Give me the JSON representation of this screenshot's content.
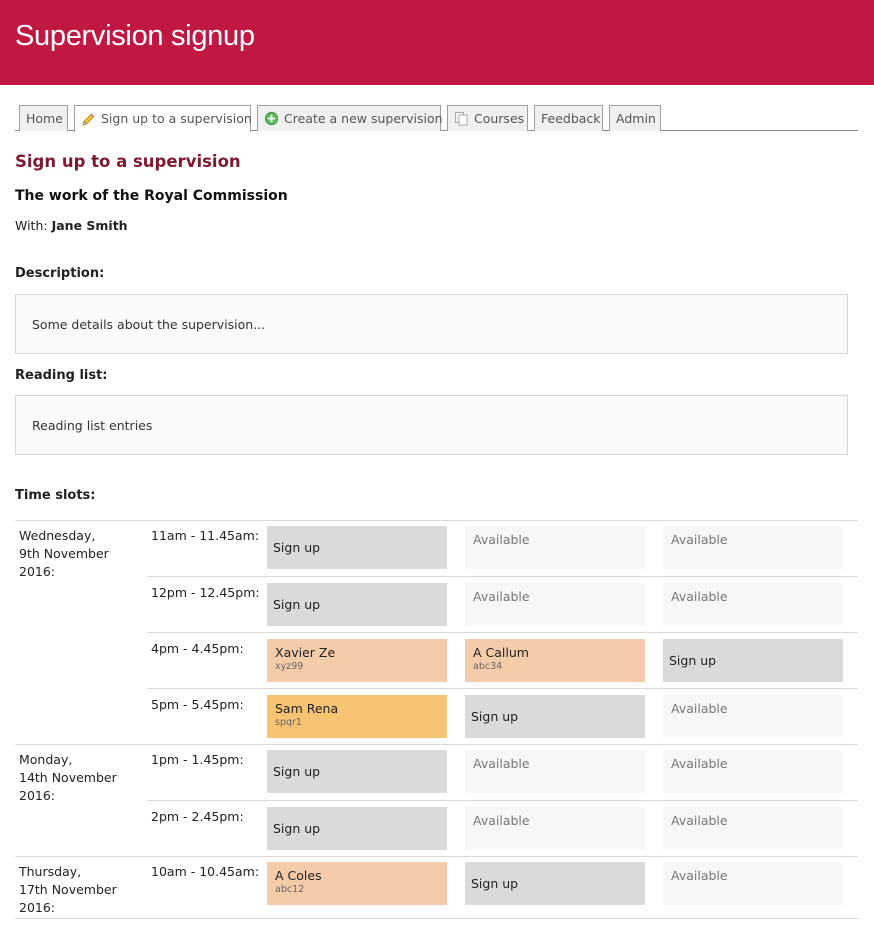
{
  "header": {
    "title": "Supervision signup"
  },
  "tabs": [
    {
      "label": "Home",
      "icon": ""
    },
    {
      "label": "Sign up to a supervision",
      "icon": "pencil-icon"
    },
    {
      "label": "Create a new supervision",
      "icon": "plus-circle-icon"
    },
    {
      "label": "Courses",
      "icon": "copy-icon"
    },
    {
      "label": "Feedback",
      "icon": ""
    },
    {
      "label": "Admin",
      "icon": ""
    }
  ],
  "page": {
    "title": "Sign up to a supervision",
    "supervision_title": "The work of the Royal Commission",
    "with_label": "With:",
    "supervisor": "Jane Smith",
    "description_label": "Description:",
    "description": "Some details about the supervision...",
    "reading_label": "Reading list:",
    "reading": "Reading list entries",
    "timeslots_label": "Time slots:"
  },
  "colors": {
    "banner": "#c01843",
    "title": "#7d1a32",
    "signup": "#dadada",
    "booked": "#f5ccaa",
    "mine": "#f6c472"
  },
  "days": [
    {
      "date_line1": "Wednesday,",
      "date_line2": "9th November",
      "date_line3": "2016:",
      "slots": [
        {
          "time": "11am - 11.45am:",
          "cells": [
            {
              "type": "signup",
              "text": "Sign up"
            },
            {
              "type": "available",
              "text": "Available"
            },
            {
              "type": "available",
              "text": "Available"
            }
          ]
        },
        {
          "time": "12pm - 12.45pm:",
          "cells": [
            {
              "type": "signup",
              "text": "Sign up"
            },
            {
              "type": "available",
              "text": "Available"
            },
            {
              "type": "available",
              "text": "Available"
            }
          ]
        },
        {
          "time": "4pm - 4.45pm:",
          "cells": [
            {
              "type": "booked",
              "name": "Xavier Ze",
              "crsid": "xyz99"
            },
            {
              "type": "booked",
              "name": "A Callum",
              "crsid": "abc34"
            },
            {
              "type": "signup",
              "text": "Sign up"
            }
          ]
        },
        {
          "time": "5pm - 5.45pm:",
          "cells": [
            {
              "type": "mine",
              "name": "Sam Rena",
              "crsid": "spqr1"
            },
            {
              "type": "signup",
              "text": "Sign up"
            },
            {
              "type": "available",
              "text": "Available"
            }
          ]
        }
      ]
    },
    {
      "date_line1": "Monday,",
      "date_line2": "14th November",
      "date_line3": "2016:",
      "slots": [
        {
          "time": "1pm - 1.45pm:",
          "cells": [
            {
              "type": "signup",
              "text": "Sign up"
            },
            {
              "type": "available",
              "text": "Available"
            },
            {
              "type": "available",
              "text": "Available"
            }
          ]
        },
        {
          "time": "2pm - 2.45pm:",
          "cells": [
            {
              "type": "signup",
              "text": "Sign up"
            },
            {
              "type": "available",
              "text": "Available"
            },
            {
              "type": "available",
              "text": "Available"
            }
          ]
        }
      ]
    },
    {
      "date_line1": "Thursday,",
      "date_line2": "17th November",
      "date_line3": "2016:",
      "slots": [
        {
          "time": "10am - 10.45am:",
          "cells": [
            {
              "type": "booked",
              "name": "A Coles",
              "crsid": "abc12"
            },
            {
              "type": "signup",
              "text": "Sign up"
            },
            {
              "type": "available",
              "text": "Available"
            }
          ]
        }
      ]
    }
  ]
}
